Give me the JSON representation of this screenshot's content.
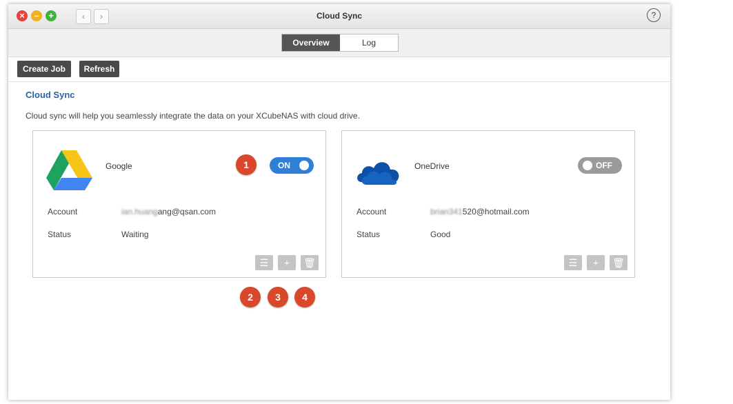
{
  "window": {
    "title": "Cloud Sync",
    "help_glyph": "?",
    "nav_back_glyph": "‹",
    "nav_fwd_glyph": "›"
  },
  "tabs": [
    {
      "label": "Overview",
      "active": true
    },
    {
      "label": "Log",
      "active": false
    }
  ],
  "toolbar": {
    "create_job_label": "Create Job",
    "refresh_label": "Refresh"
  },
  "section": {
    "heading": "Cloud Sync",
    "description": "Cloud sync will help you seamlessly integrate the data on your XCubeNAS with cloud drive."
  },
  "cards": [
    {
      "service": "Google",
      "icon": "google-drive-icon",
      "toggle_label": "ON",
      "toggle_state": "on",
      "account_label": "Account",
      "account_prefix": "ian.huang",
      "account_value": "ang@qsan.com",
      "status_label": "Status",
      "status_value": "Waiting"
    },
    {
      "service": "OneDrive",
      "icon": "onedrive-icon",
      "toggle_label": "OFF",
      "toggle_state": "off",
      "account_label": "Account",
      "account_prefix": "brian341",
      "account_value": "520@hotmail.com",
      "status_label": "Status",
      "status_value": "Good"
    }
  ],
  "callouts": [
    "1",
    "2",
    "3",
    "4"
  ],
  "colors": {
    "accent_blue": "#2f7fd6",
    "heading_blue": "#2e5fa8",
    "callout_red": "#d9482b",
    "toggle_off_gray": "#9b9b9b"
  }
}
